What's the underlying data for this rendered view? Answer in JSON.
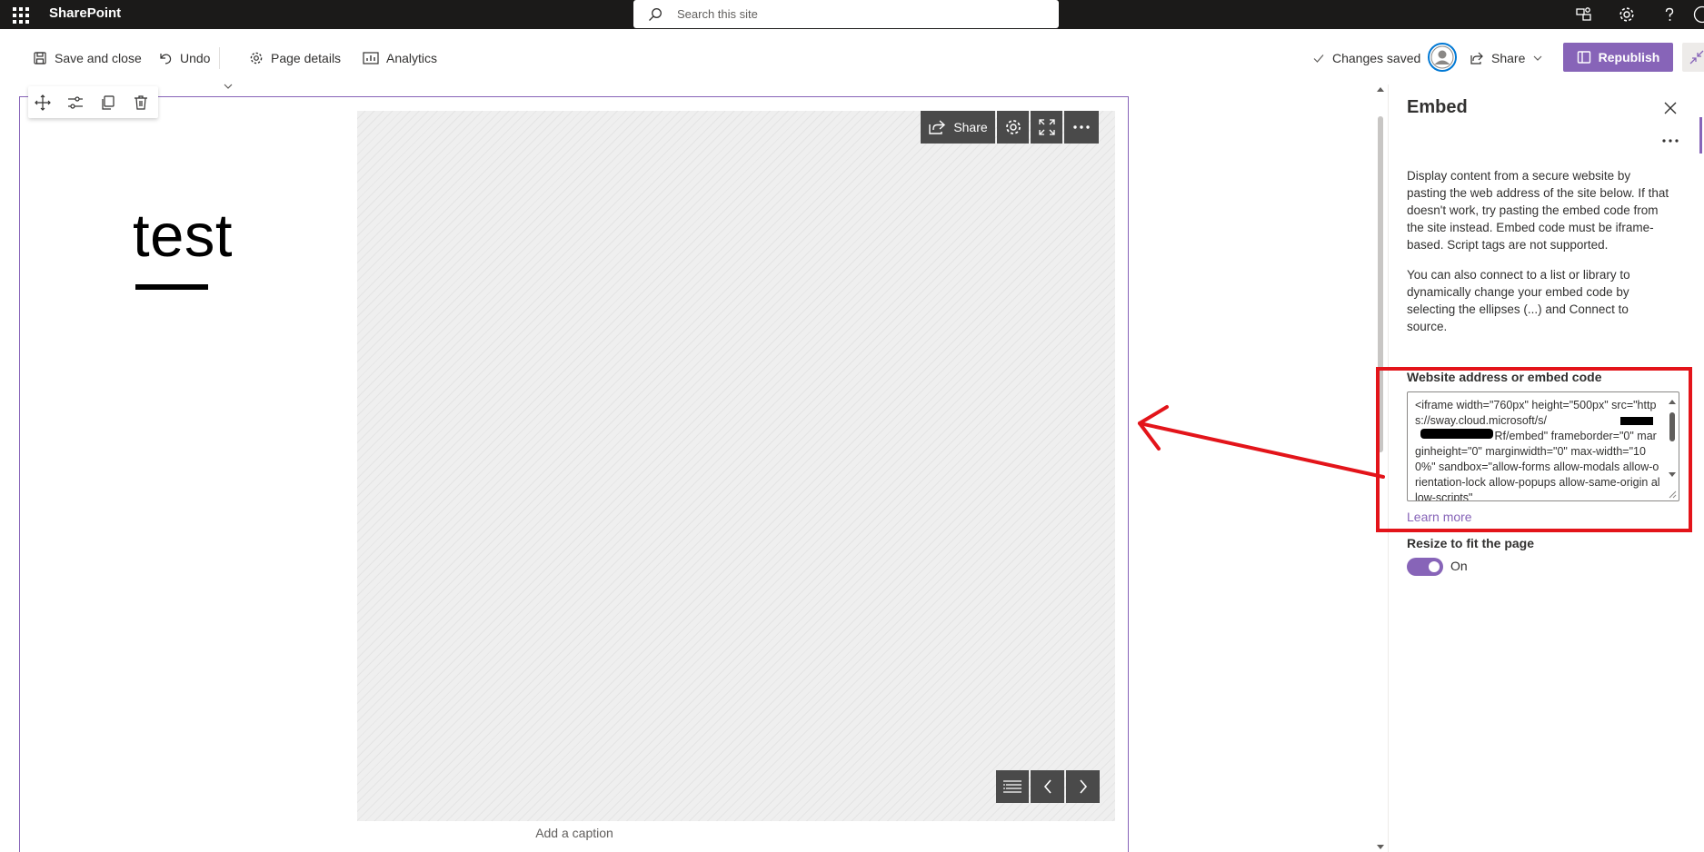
{
  "suitebar": {
    "app_name": "SharePoint",
    "search_placeholder": "Search this site",
    "icons": [
      "waffle-icon",
      "feedback-icon",
      "settings-icon",
      "help-icon",
      "account-icon"
    ]
  },
  "commandbar": {
    "save_close": "Save and close",
    "undo": "Undo",
    "page_details": "Page details",
    "analytics": "Analytics",
    "status": "Changes saved",
    "share": "Share",
    "republish": "Republish"
  },
  "canvas": {
    "title": "test",
    "section_tools": [
      "move-icon",
      "edit-properties-icon",
      "duplicate-icon",
      "delete-icon"
    ],
    "embed_toolbar": {
      "share": "Share",
      "icons": [
        "settings-icon",
        "fullscreen-icon",
        "more-icon"
      ]
    },
    "embed_nav": [
      "navigation-icon",
      "previous-icon",
      "next-icon"
    ],
    "caption_placeholder": "Add a caption"
  },
  "pane": {
    "title": "Embed",
    "description1": "Display content from a secure website by pasting the web address of the site below. If that doesn't work, try pasting the embed code from the site instead. Embed code must be iframe-based. Script tags are not supported.",
    "description2": "You can also connect to a list or library to dynamically change your embed code by selecting the ellipses (...) and Connect to source.",
    "field_label": "Website address or embed code",
    "embed_code": "<iframe width=\"760px\" height=\"500px\" src=\"https://sway.cloud.microsoft/s/                 Rf/embed\" frameborder=\"0\" marginheight=\"0\" marginwidth=\"0\" max-width=\"100%\" sandbox=\"allow-forms allow-modals allow-orientation-lock allow-popups allow-same-origin allow-scripts\"",
    "learn_more": "Learn more",
    "toggle_label": "Resize to fit the page",
    "toggle_state": "On"
  },
  "colors": {
    "accent": "#8764b8",
    "suitebar": "#1b1a19",
    "annotation": "#e3141a"
  }
}
